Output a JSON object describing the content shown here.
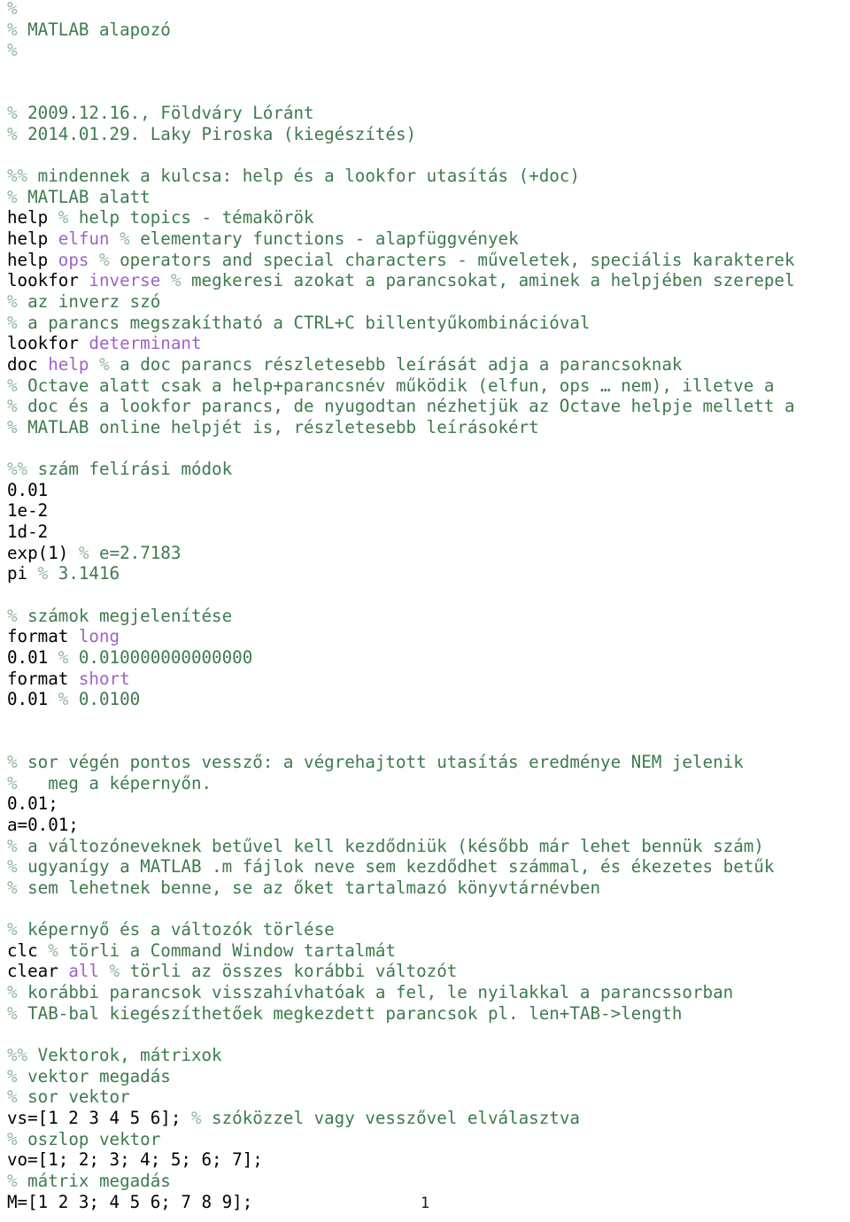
{
  "document": {
    "kind": "matlab-script-listing",
    "language": "hu",
    "page_number": "1",
    "colors": {
      "comment": "#3E7A4E",
      "percent_sign": "#8FB89A",
      "code": "#000000",
      "argument": "#9D63C6",
      "background": "#FFFFFF"
    }
  },
  "lines": [
    {
      "id": "l1",
      "segments": [
        {
          "cls": "pc",
          "text": "%"
        }
      ]
    },
    {
      "id": "l2",
      "segments": [
        {
          "cls": "pc",
          "text": "%"
        },
        {
          "cls": "c",
          "text": " MATLAB alapozó"
        }
      ]
    },
    {
      "id": "l3",
      "segments": [
        {
          "cls": "pc",
          "text": "%"
        }
      ]
    },
    {
      "id": "l4",
      "segments": []
    },
    {
      "id": "l5",
      "segments": []
    },
    {
      "id": "l6",
      "segments": [
        {
          "cls": "pc",
          "text": "%"
        },
        {
          "cls": "c",
          "text": " 2009.12.16., Földváry Lóránt"
        }
      ]
    },
    {
      "id": "l7",
      "segments": [
        {
          "cls": "pc",
          "text": "%"
        },
        {
          "cls": "c",
          "text": " 2014.01.29. Laky Piroska (kiegészítés)"
        }
      ]
    },
    {
      "id": "l8",
      "segments": []
    },
    {
      "id": "l9",
      "segments": [
        {
          "cls": "pc",
          "text": "%%"
        },
        {
          "cls": "c",
          "text": " mindennek a kulcsa: help és a lookfor utasítás (+doc)"
        }
      ]
    },
    {
      "id": "l10",
      "segments": [
        {
          "cls": "pc",
          "text": "%"
        },
        {
          "cls": "c",
          "text": " MATLAB alatt"
        }
      ]
    },
    {
      "id": "l11",
      "segments": [
        {
          "cls": "k",
          "text": "help "
        },
        {
          "cls": "pc",
          "text": "%"
        },
        {
          "cls": "c",
          "text": " help topics - témakörök"
        }
      ]
    },
    {
      "id": "l12",
      "segments": [
        {
          "cls": "k",
          "text": "help "
        },
        {
          "cls": "a",
          "text": "elfun"
        },
        {
          "cls": "k",
          "text": " "
        },
        {
          "cls": "pc",
          "text": "%"
        },
        {
          "cls": "c",
          "text": " elementary functions - alapfüggvények"
        }
      ]
    },
    {
      "id": "l13",
      "segments": [
        {
          "cls": "k",
          "text": "help "
        },
        {
          "cls": "a",
          "text": "ops"
        },
        {
          "cls": "k",
          "text": " "
        },
        {
          "cls": "pc",
          "text": "%"
        },
        {
          "cls": "c",
          "text": " operators and special characters - műveletek, speciális karakterek"
        }
      ]
    },
    {
      "id": "l14",
      "segments": [
        {
          "cls": "k",
          "text": "lookfor "
        },
        {
          "cls": "a",
          "text": "inverse"
        },
        {
          "cls": "k",
          "text": " "
        },
        {
          "cls": "pc",
          "text": "%"
        },
        {
          "cls": "c",
          "text": " megkeresi azokat a parancsokat, aminek a helpjében szerepel"
        }
      ]
    },
    {
      "id": "l15",
      "segments": [
        {
          "cls": "pc",
          "text": "%"
        },
        {
          "cls": "c",
          "text": " az inverz szó"
        }
      ]
    },
    {
      "id": "l16",
      "segments": [
        {
          "cls": "pc",
          "text": "%"
        },
        {
          "cls": "c",
          "text": " a parancs megszakítható a CTRL+C billentyűkombinációval"
        }
      ]
    },
    {
      "id": "l17",
      "segments": [
        {
          "cls": "k",
          "text": "lookfor "
        },
        {
          "cls": "a",
          "text": "determinant"
        }
      ]
    },
    {
      "id": "l18",
      "segments": [
        {
          "cls": "k",
          "text": "doc "
        },
        {
          "cls": "a",
          "text": "help"
        },
        {
          "cls": "k",
          "text": " "
        },
        {
          "cls": "pc",
          "text": "%"
        },
        {
          "cls": "c",
          "text": " a doc parancs részletesebb leírását adja a parancsoknak"
        }
      ]
    },
    {
      "id": "l19",
      "segments": [
        {
          "cls": "pc",
          "text": "%"
        },
        {
          "cls": "c",
          "text": " Octave alatt csak a help+parancsnév működik (elfun, ops … nem), illetve a"
        }
      ]
    },
    {
      "id": "l20",
      "segments": [
        {
          "cls": "pc",
          "text": "%"
        },
        {
          "cls": "c",
          "text": " doc és a lookfor parancs, de nyugodtan nézhetjük az Octave helpje mellett a"
        }
      ]
    },
    {
      "id": "l21",
      "segments": [
        {
          "cls": "pc",
          "text": "%"
        },
        {
          "cls": "c",
          "text": " MATLAB online helpjét is, részletesebb leírásokért"
        }
      ]
    },
    {
      "id": "l22",
      "segments": []
    },
    {
      "id": "l23",
      "segments": [
        {
          "cls": "pc",
          "text": "%%"
        },
        {
          "cls": "c",
          "text": " szám felírási módok"
        }
      ]
    },
    {
      "id": "l24",
      "segments": [
        {
          "cls": "k",
          "text": "0.01"
        }
      ]
    },
    {
      "id": "l25",
      "segments": [
        {
          "cls": "k",
          "text": "1e-2"
        }
      ]
    },
    {
      "id": "l26",
      "segments": [
        {
          "cls": "k",
          "text": "1d-2"
        }
      ]
    },
    {
      "id": "l27",
      "segments": [
        {
          "cls": "k",
          "text": "exp(1) "
        },
        {
          "cls": "pc",
          "text": "%"
        },
        {
          "cls": "c",
          "text": " e=2.7183"
        }
      ]
    },
    {
      "id": "l28",
      "segments": [
        {
          "cls": "k",
          "text": "pi "
        },
        {
          "cls": "pc",
          "text": "%"
        },
        {
          "cls": "c",
          "text": " 3.1416"
        }
      ]
    },
    {
      "id": "l29",
      "segments": []
    },
    {
      "id": "l30",
      "segments": [
        {
          "cls": "pc",
          "text": "%"
        },
        {
          "cls": "c",
          "text": " számok megjelenítése"
        }
      ]
    },
    {
      "id": "l31",
      "segments": [
        {
          "cls": "k",
          "text": "format "
        },
        {
          "cls": "a",
          "text": "long"
        }
      ]
    },
    {
      "id": "l32",
      "segments": [
        {
          "cls": "k",
          "text": "0.01 "
        },
        {
          "cls": "pc",
          "text": "%"
        },
        {
          "cls": "c",
          "text": " 0.010000000000000"
        }
      ]
    },
    {
      "id": "l33",
      "segments": [
        {
          "cls": "k",
          "text": "format "
        },
        {
          "cls": "a",
          "text": "short"
        }
      ]
    },
    {
      "id": "l34",
      "segments": [
        {
          "cls": "k",
          "text": "0.01 "
        },
        {
          "cls": "pc",
          "text": "%"
        },
        {
          "cls": "c",
          "text": " 0.0100"
        }
      ]
    },
    {
      "id": "l35",
      "segments": []
    },
    {
      "id": "l36",
      "segments": []
    },
    {
      "id": "l37",
      "segments": [
        {
          "cls": "pc",
          "text": "%"
        },
        {
          "cls": "c",
          "text": " sor végén pontos vessző: a végrehajtott utasítás eredménye NEM jelenik"
        }
      ]
    },
    {
      "id": "l38",
      "segments": [
        {
          "cls": "pc",
          "text": "%"
        },
        {
          "cls": "c",
          "text": "   meg a képernyőn."
        }
      ]
    },
    {
      "id": "l39",
      "segments": [
        {
          "cls": "k",
          "text": "0.01;"
        }
      ]
    },
    {
      "id": "l40",
      "segments": [
        {
          "cls": "k",
          "text": "a=0.01;"
        }
      ]
    },
    {
      "id": "l41",
      "segments": [
        {
          "cls": "pc",
          "text": "%"
        },
        {
          "cls": "c",
          "text": " a változóneveknek betűvel kell kezdődniük (később már lehet bennük szám)"
        }
      ]
    },
    {
      "id": "l42",
      "segments": [
        {
          "cls": "pc",
          "text": "%"
        },
        {
          "cls": "c",
          "text": " ugyanígy a MATLAB .m fájlok neve sem kezdődhet számmal, és ékezetes betűk"
        }
      ]
    },
    {
      "id": "l43",
      "segments": [
        {
          "cls": "pc",
          "text": "%"
        },
        {
          "cls": "c",
          "text": " sem lehetnek benne, se az őket tartalmazó könyvtárnévben"
        }
      ]
    },
    {
      "id": "l44",
      "segments": []
    },
    {
      "id": "l45",
      "segments": [
        {
          "cls": "pc",
          "text": "%"
        },
        {
          "cls": "c",
          "text": " képernyő és a változók törlése"
        }
      ]
    },
    {
      "id": "l46",
      "segments": [
        {
          "cls": "k",
          "text": "clc "
        },
        {
          "cls": "pc",
          "text": "%"
        },
        {
          "cls": "c",
          "text": " törli a Command Window tartalmát"
        }
      ]
    },
    {
      "id": "l47",
      "segments": [
        {
          "cls": "k",
          "text": "clear "
        },
        {
          "cls": "a",
          "text": "all"
        },
        {
          "cls": "k",
          "text": " "
        },
        {
          "cls": "pc",
          "text": "%"
        },
        {
          "cls": "c",
          "text": " törli az összes korábbi változót"
        }
      ]
    },
    {
      "id": "l48",
      "segments": [
        {
          "cls": "pc",
          "text": "%"
        },
        {
          "cls": "c",
          "text": " korábbi parancsok visszahívhatóak a fel, le nyilakkal a parancssorban"
        }
      ]
    },
    {
      "id": "l49",
      "segments": [
        {
          "cls": "pc",
          "text": "%"
        },
        {
          "cls": "c",
          "text": " TAB-bal kiegészíthetőek megkezdett parancsok pl. len+TAB->length"
        }
      ]
    },
    {
      "id": "l50",
      "segments": []
    },
    {
      "id": "l51",
      "segments": [
        {
          "cls": "pc",
          "text": "%%"
        },
        {
          "cls": "c",
          "text": " Vektorok, mátrixok"
        }
      ]
    },
    {
      "id": "l52",
      "segments": [
        {
          "cls": "pc",
          "text": "%"
        },
        {
          "cls": "c",
          "text": " vektor megadás"
        }
      ]
    },
    {
      "id": "l53",
      "segments": [
        {
          "cls": "pc",
          "text": "%"
        },
        {
          "cls": "c",
          "text": " sor vektor"
        }
      ]
    },
    {
      "id": "l54",
      "segments": [
        {
          "cls": "k",
          "text": "vs=[1 2 3 4 5 6]; "
        },
        {
          "cls": "pc",
          "text": "%"
        },
        {
          "cls": "c",
          "text": " szóközzel vagy vesszővel elválasztva"
        }
      ]
    },
    {
      "id": "l55",
      "segments": [
        {
          "cls": "pc",
          "text": "%"
        },
        {
          "cls": "c",
          "text": " oszlop vektor"
        }
      ]
    },
    {
      "id": "l56",
      "segments": [
        {
          "cls": "k",
          "text": "vo=[1; 2; 3; 4; 5; 6; 7];"
        }
      ]
    },
    {
      "id": "l57",
      "segments": [
        {
          "cls": "pc",
          "text": "%"
        },
        {
          "cls": "c",
          "text": " mátrix megadás"
        }
      ]
    },
    {
      "id": "l58",
      "segments": [
        {
          "cls": "k",
          "text": "M=[1 2 3; 4 5 6; 7 8 9];"
        }
      ]
    }
  ]
}
